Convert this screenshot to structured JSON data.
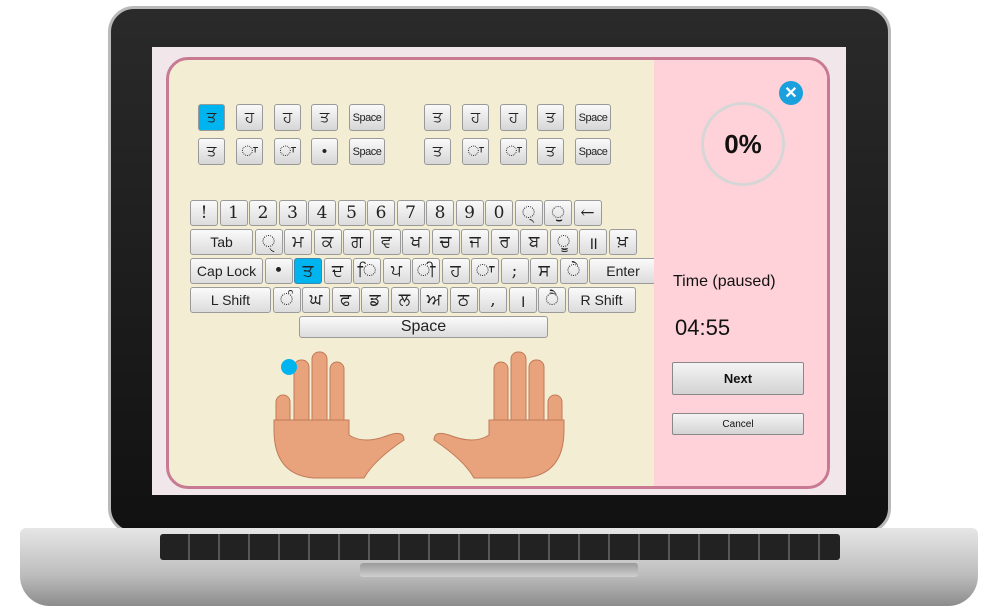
{
  "lesson": {
    "rows": [
      [
        {
          "l": "ਤ",
          "hl": true
        },
        {
          "l": "ਹ"
        },
        {
          "l": "ਹ"
        },
        {
          "l": "ਤ"
        },
        {
          "l": "Space"
        },
        {
          "l": "ਤ"
        },
        {
          "l": "ਹ"
        },
        {
          "l": "ਹ"
        },
        {
          "l": "ਤ"
        },
        {
          "l": "Space"
        }
      ],
      [
        {
          "l": "ਤ"
        },
        {
          "l": "ਾ"
        },
        {
          "l": "ਾ"
        },
        {
          "l": "•"
        },
        {
          "l": "Space"
        },
        {
          "l": "ਤ"
        },
        {
          "l": "ਾ"
        },
        {
          "l": "ਾ"
        },
        {
          "l": "ਤ"
        },
        {
          "l": "Space"
        }
      ]
    ]
  },
  "keyboard": {
    "highlight": "ਤ",
    "rows": [
      [
        "!",
        "1",
        "2",
        "3",
        "4",
        "5",
        "6",
        "7",
        "8",
        "9",
        "0",
        "੍",
        "ੁ",
        "←"
      ],
      [
        "Tab",
        "ੑ",
        "ਮ",
        "ਕ",
        "ਗ",
        "ਵ",
        "ਖ",
        "ਚ",
        "ਜ",
        "ਰ",
        "ਬ",
        "ੂ",
        "॥",
        "ਖ਼"
      ],
      [
        "Cap Lock",
        "•",
        "ਤ",
        "ਦ",
        "ਿ",
        "ਪ",
        "ੀ",
        "ਹ",
        "ਾ",
        ";",
        "ਸ",
        "ੇ",
        "Enter"
      ],
      [
        "L Shift",
        "ੰ",
        "ਘ",
        "ਫ",
        "ਡ",
        "ਲ",
        "ਅ",
        "ਠ",
        ",",
        "।",
        "ੈ",
        "R Shift"
      ]
    ],
    "space": "Space"
  },
  "finger_indicator": "left-index",
  "accent": "#00b4f0",
  "progress": {
    "value": "0%",
    "percent": 0
  },
  "time": {
    "label": "Time (paused)",
    "value": "04:55"
  },
  "buttons": {
    "next": "Next",
    "cancel": "Cancel"
  },
  "icons": {
    "close": "close-icon"
  }
}
